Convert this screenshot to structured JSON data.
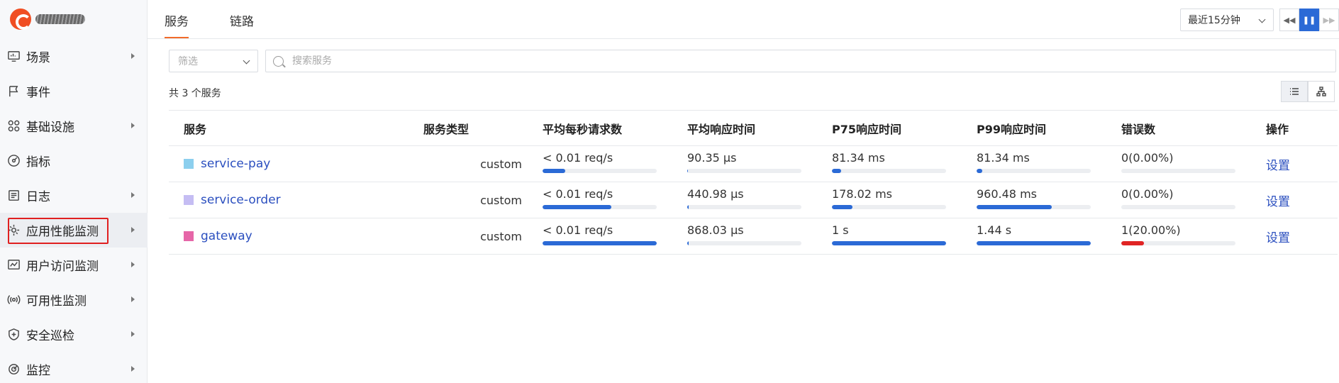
{
  "sidebar": {
    "items": [
      {
        "label": "场景",
        "icon": "monitor-icon",
        "arrow": true
      },
      {
        "label": "事件",
        "icon": "flag-icon",
        "arrow": false
      },
      {
        "label": "基础设施",
        "icon": "grid-icon",
        "arrow": true
      },
      {
        "label": "指标",
        "icon": "gauge-icon",
        "arrow": false
      },
      {
        "label": "日志",
        "icon": "log-icon",
        "arrow": true
      },
      {
        "label": "应用性能监测",
        "icon": "apm-icon",
        "arrow": true
      },
      {
        "label": "用户访问监测",
        "icon": "chart-window-icon",
        "arrow": true
      },
      {
        "label": "可用性监测",
        "icon": "signal-icon",
        "arrow": true
      },
      {
        "label": "安全巡检",
        "icon": "shield-icon",
        "arrow": true
      },
      {
        "label": "监控",
        "icon": "radar-icon",
        "arrow": true
      }
    ]
  },
  "header": {
    "tabs": [
      "服务",
      "链路"
    ],
    "time_range": "最近15分钟"
  },
  "filters": {
    "filter_placeholder": "筛选",
    "search_placeholder": "搜索服务"
  },
  "summary": {
    "count_text": "共 3 个服务"
  },
  "table": {
    "columns": [
      "服务",
      "服务类型",
      "平均每秒请求数",
      "平均响应时间",
      "P75响应时间",
      "P99响应时间",
      "错误数",
      "操作"
    ],
    "rows": [
      {
        "service": "service-pay",
        "color": "#8ccfee",
        "type": "custom",
        "rps": "< 0.01 req/s",
        "rps_ratio": 0.2,
        "avg": "90.35 μs",
        "avg_ratio": 0.001,
        "p75": "81.34 ms",
        "p75_ratio": 0.08,
        "p99": "81.34 ms",
        "p99_ratio": 0.05,
        "errors": "0(0.00%)",
        "errors_ratio": 0,
        "action": "设置"
      },
      {
        "service": "service-order",
        "color": "#c5bdf3",
        "type": "custom",
        "rps": "< 0.01 req/s",
        "rps_ratio": 0.6,
        "avg": "440.98 μs",
        "avg_ratio": 0.01,
        "p75": "178.02 ms",
        "p75_ratio": 0.18,
        "p99": "960.48 ms",
        "p99_ratio": 0.66,
        "errors": "0(0.00%)",
        "errors_ratio": 0,
        "action": "设置"
      },
      {
        "service": "gateway",
        "color": "#e666a8",
        "type": "custom",
        "rps": "< 0.01 req/s",
        "rps_ratio": 1.0,
        "avg": "868.03 μs",
        "avg_ratio": 0.01,
        "p75": "1 s",
        "p75_ratio": 1.0,
        "p99": "1.44 s",
        "p99_ratio": 1.0,
        "errors": "1(20.00%)",
        "errors_ratio": 0.2,
        "action": "设置"
      }
    ]
  },
  "colors": {
    "bar_primary": "#2b6ad6",
    "bar_error": "#e02424",
    "accent": "#f26b2a"
  }
}
